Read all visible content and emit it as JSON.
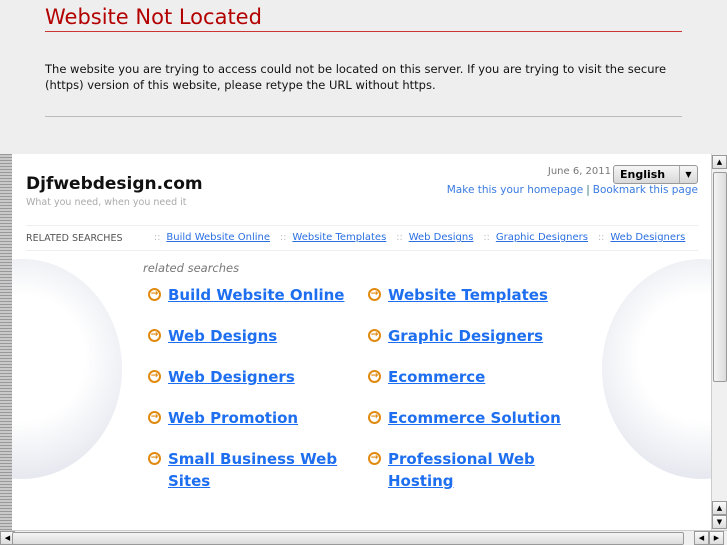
{
  "error": {
    "title": "Website Not Located",
    "message": "The website you are trying to access could not be located on this server. If you are trying to visit the secure (https) version of this website, please retype the URL without https."
  },
  "site": {
    "logo": "Djfwebdesign.com",
    "tagline": "What you need, when you need it",
    "date": "June 6, 2011",
    "language": "English",
    "homepage_link": "Make this your homepage",
    "bookmark_link": "Bookmark this page",
    "related_bar_label": "RELATED SEARCHES",
    "separator": "::",
    "related_bar_links": [
      "Build Website Online",
      "Website Templates",
      "Web Designs",
      "Graphic Designers",
      "Web Designers"
    ],
    "related_title": "related searches",
    "related_links": [
      "Build Website Online",
      "Website Templates",
      "Web Designs",
      "Graphic Designers",
      "Web Designers",
      "Ecommerce",
      "Web Promotion",
      "Ecommerce Solution",
      "Small Business Web Sites",
      "Professional Web Hosting"
    ]
  },
  "colors": {
    "error_red": "#b30000",
    "link_blue": "#1e6ef0",
    "bullet_orange": "#e08a10"
  }
}
